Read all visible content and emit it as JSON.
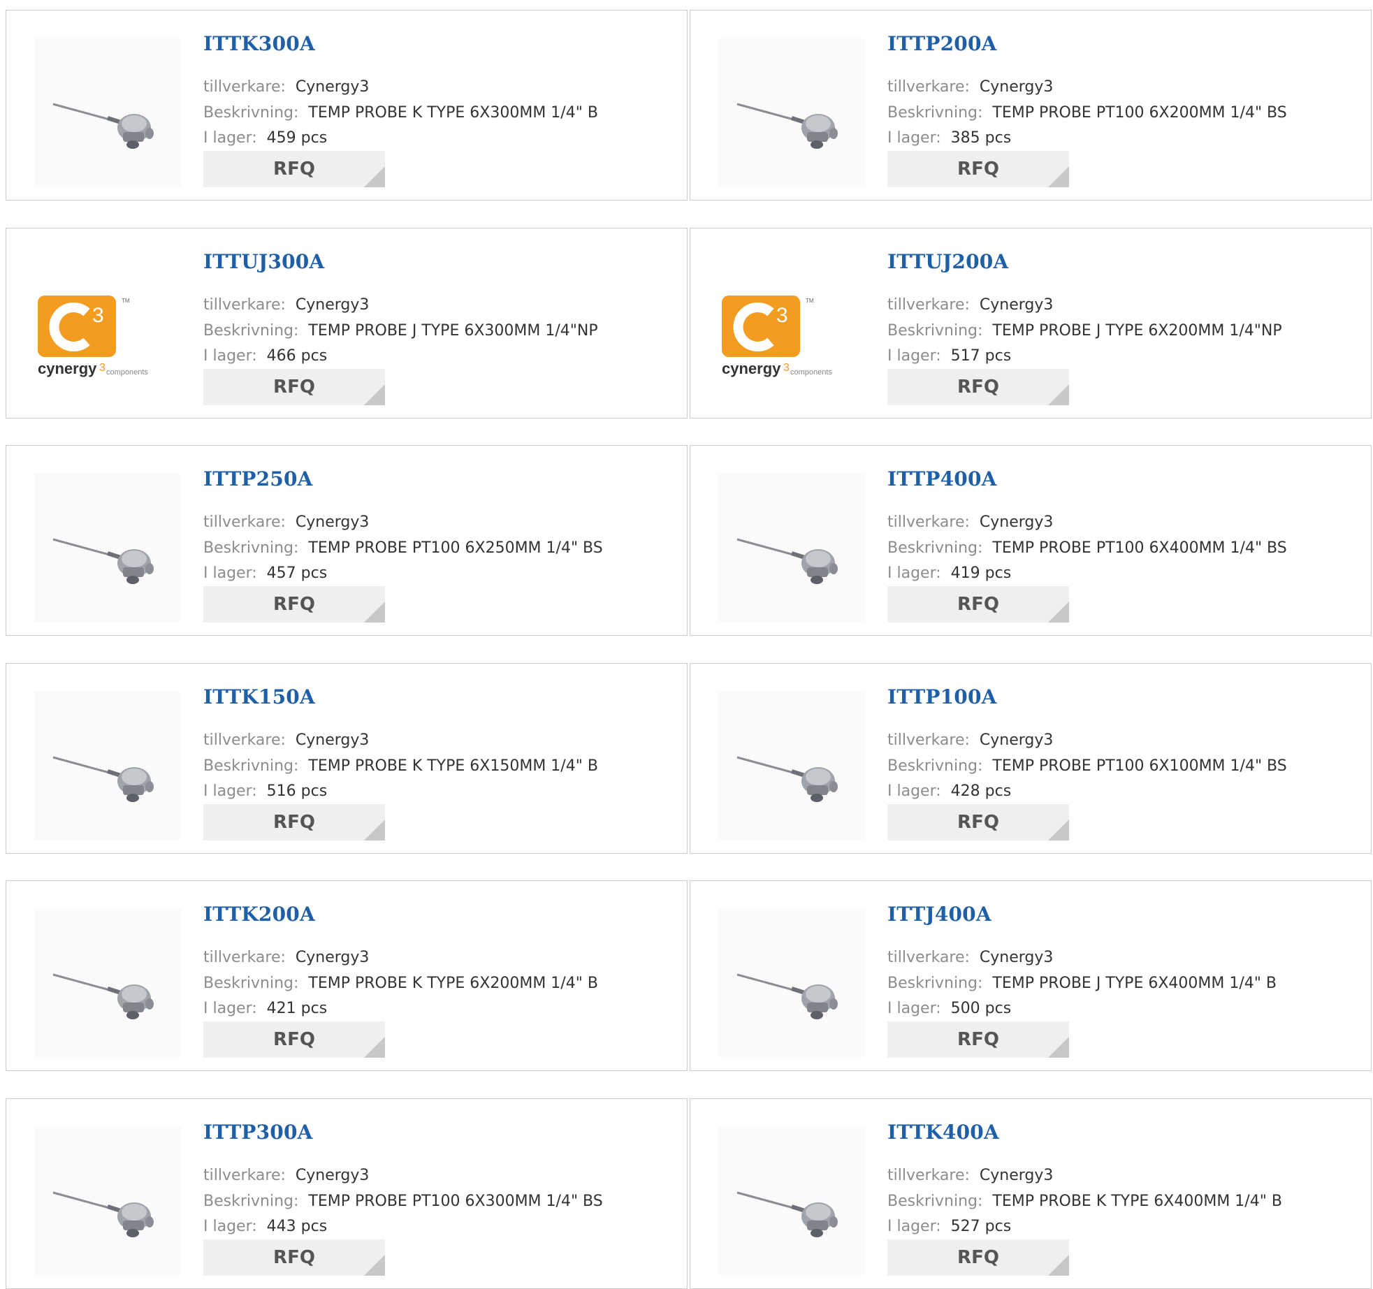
{
  "labels": {
    "manufacturer": "tillverkare:",
    "description": "Beskrivning:",
    "stock": "I lager:",
    "rfq": "RFQ"
  },
  "colors": {
    "part_link": "#1f5fa8",
    "label": "#8c8c8c",
    "value": "#333333",
    "rfq_bg": "#efefef",
    "logo_orange": "#f39c1f"
  },
  "products": [
    {
      "part": "ITTK300A",
      "manufacturer": "Cynergy3",
      "description": "TEMP PROBE K TYPE 6X300MM 1/4\" B",
      "stock": "459 pcs",
      "image": "temp-probe"
    },
    {
      "part": "ITTP200A",
      "manufacturer": "Cynergy3",
      "description": "TEMP PROBE PT100 6X200MM 1/4\" BS",
      "stock": "385 pcs",
      "image": "temp-probe"
    },
    {
      "part": "ITTUJ300A",
      "manufacturer": "Cynergy3",
      "description": "TEMP PROBE J TYPE 6X300MM 1/4\"NP",
      "stock": "466 pcs",
      "image": "cynergy3-logo"
    },
    {
      "part": "ITTUJ200A",
      "manufacturer": "Cynergy3",
      "description": "TEMP PROBE J TYPE 6X200MM 1/4\"NP",
      "stock": "517 pcs",
      "image": "cynergy3-logo"
    },
    {
      "part": "ITTP250A",
      "manufacturer": "Cynergy3",
      "description": "TEMP PROBE PT100 6X250MM 1/4\" BS",
      "stock": "457 pcs",
      "image": "temp-probe"
    },
    {
      "part": "ITTP400A",
      "manufacturer": "Cynergy3",
      "description": "TEMP PROBE PT100 6X400MM 1/4\" BS",
      "stock": "419 pcs",
      "image": "temp-probe"
    },
    {
      "part": "ITTK150A",
      "manufacturer": "Cynergy3",
      "description": "TEMP PROBE K TYPE 6X150MM 1/4\" B",
      "stock": "516 pcs",
      "image": "temp-probe"
    },
    {
      "part": "ITTP100A",
      "manufacturer": "Cynergy3",
      "description": "TEMP PROBE PT100 6X100MM 1/4\" BS",
      "stock": "428 pcs",
      "image": "temp-probe"
    },
    {
      "part": "ITTK200A",
      "manufacturer": "Cynergy3",
      "description": "TEMP PROBE K TYPE 6X200MM 1/4\" B",
      "stock": "421 pcs",
      "image": "temp-probe"
    },
    {
      "part": "ITTJ400A",
      "manufacturer": "Cynergy3",
      "description": "TEMP PROBE J TYPE 6X400MM 1/4\" B",
      "stock": "500 pcs",
      "image": "temp-probe"
    },
    {
      "part": "ITTP300A",
      "manufacturer": "Cynergy3",
      "description": "TEMP PROBE PT100 6X300MM 1/4\" BS",
      "stock": "443 pcs",
      "image": "temp-probe"
    },
    {
      "part": "ITTK400A",
      "manufacturer": "Cynergy3",
      "description": "TEMP PROBE K TYPE 6X400MM 1/4\" B",
      "stock": "527 pcs",
      "image": "temp-probe"
    }
  ]
}
